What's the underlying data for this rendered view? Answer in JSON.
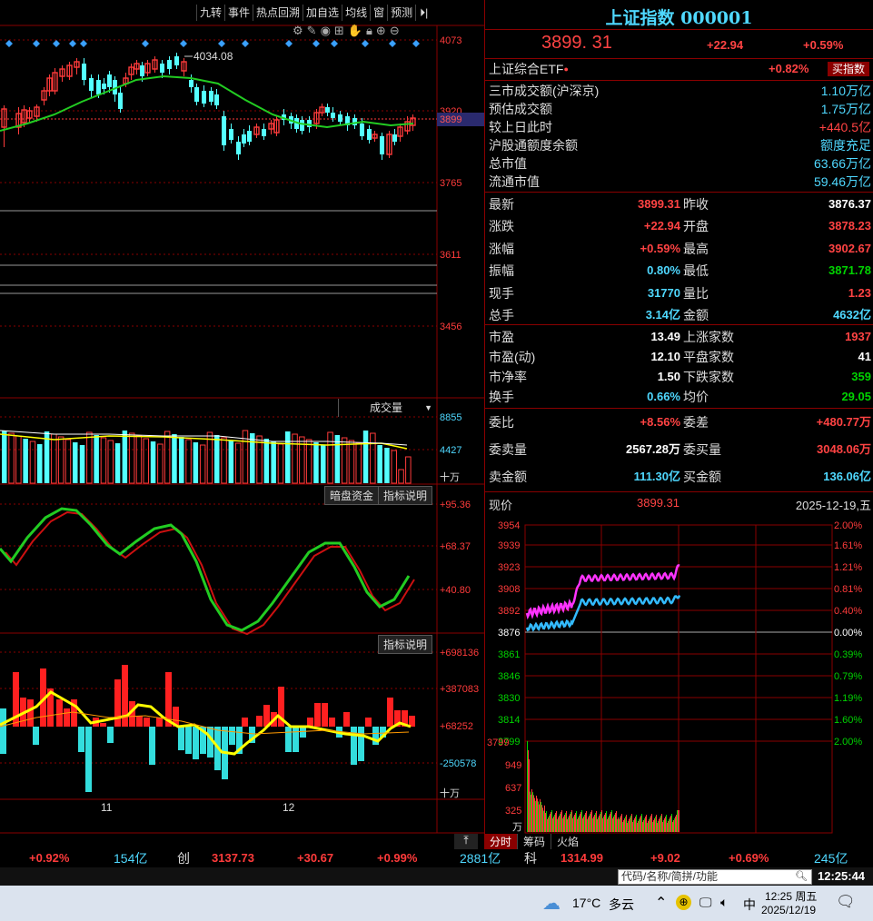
{
  "toolbar": {
    "items": [
      "九转",
      "事件",
      "热点回溯",
      "加自选",
      "均线",
      "窗",
      "预测"
    ]
  },
  "chart_tools": [
    "gear-icon",
    "pen-icon",
    "eye-icon",
    "basket-icon",
    "hand-icon",
    "lock-icon",
    "zoom-in-icon",
    "zoom-out-icon"
  ],
  "main_chart": {
    "price_labels": [
      "4073",
      "3920",
      "3899",
      "3765",
      "3611",
      "3456"
    ],
    "high_label": "4034.08",
    "x_labels": [
      "11",
      "12"
    ],
    "volume_header": "成交量",
    "volume_labels": [
      "8855",
      "4427",
      "十万"
    ],
    "dark_pool_btn": "暗盘资金",
    "indicator_btn": "指标说明",
    "indicator_btn2": "指标说明",
    "osc_labels": [
      "+95.36",
      "+68.37",
      "+40.80"
    ],
    "flow_labels": [
      "+698136",
      "+387083",
      "+68252",
      "-250578",
      "十万"
    ]
  },
  "quote": {
    "title": "上证指数 000001",
    "price": "3899. 31",
    "change": "+22.94",
    "pct": "+0.59%",
    "etf_label": "上证综合ETF",
    "etf_pct": "+0.82%",
    "buy_index_btn": "买指数",
    "info_rows": [
      {
        "label": "三市成交额(沪深京)",
        "value": "1.10万亿"
      },
      {
        "label": "预估成交额",
        "value": "1.75万亿"
      },
      {
        "label": "较上日此时",
        "value": "+440.5亿"
      },
      {
        "label": "沪股通额度余额",
        "value": "额度充足"
      },
      {
        "label": "总市值",
        "value": "63.66万亿"
      },
      {
        "label": "流通市值",
        "value": "59.46万亿"
      }
    ],
    "grid": [
      {
        "l1": "最新",
        "v1": "3899.31",
        "l2": "昨收",
        "v2": "3876.37"
      },
      {
        "l1": "涨跌",
        "v1": "+22.94",
        "l2": "开盘",
        "v2": "3878.23"
      },
      {
        "l1": "涨幅",
        "v1": "+0.59%",
        "l2": "最高",
        "v2": "3902.67"
      },
      {
        "l1": "振幅",
        "v1": "0.80%",
        "l2": "最低",
        "v2": "3871.78"
      },
      {
        "l1": "现手",
        "v1": "31770",
        "l2": "量比",
        "v2": "1.23"
      },
      {
        "l1": "总手",
        "v1": "3.14亿",
        "l2": "金额",
        "v2": "4632亿"
      }
    ],
    "grid2": [
      {
        "l1": "市盈",
        "v1": "13.49",
        "l2": "上涨家数",
        "v2": "1937"
      },
      {
        "l1": "市盈(动)",
        "v1": "12.10",
        "l2": "平盘家数",
        "v2": "41"
      },
      {
        "l1": "市净率",
        "v1": "1.50",
        "l2": "下跌家数",
        "v2": "359"
      },
      {
        "l1": "换手",
        "v1": "0.66%",
        "l2": "均价",
        "v2": "29.05"
      }
    ],
    "grid3": [
      {
        "l1": "委比",
        "v1": "+8.56%",
        "l2": "委差",
        "v2": "+480.77万"
      },
      {
        "l1": "委卖量",
        "v1": "2567.28万",
        "l2": "委买量",
        "v2": "3048.06万"
      },
      {
        "l1": "卖金额",
        "v1": "111.30亿",
        "l2": "买金额",
        "v2": "136.06亿"
      }
    ]
  },
  "intraday": {
    "header_label": "现价",
    "header_price": "3899.31",
    "header_date": "2025-12-19,五",
    "left_labels": [
      "3954",
      "3939",
      "3923",
      "3908",
      "3892",
      "3876",
      "3861",
      "3846",
      "3830",
      "3814",
      "3799"
    ],
    "right_labels": [
      "2.00%",
      "1.61%",
      "1.21%",
      "0.81%",
      "0.40%",
      "0.00%",
      "0.39%",
      "0.79%",
      "1.19%",
      "1.60%",
      "2.00%"
    ],
    "vol_labels": [
      "949",
      "637",
      "325",
      "万"
    ],
    "tabs": [
      "分时",
      "筹码",
      "火焰"
    ]
  },
  "bottom_bar": {
    "items": [
      {
        "text": "+0.92%",
        "color": "red"
      },
      {
        "text": "154亿",
        "color": "cyan"
      },
      {
        "text": "创",
        "color": "white"
      },
      {
        "text": "3137.73",
        "color": "red"
      },
      {
        "text": "+30.67",
        "color": "red"
      },
      {
        "text": "+0.99%",
        "color": "red"
      },
      {
        "text": "2881亿",
        "color": "cyan"
      },
      {
        "text": "科",
        "color": "white"
      },
      {
        "text": "1314.99",
        "color": "red"
      },
      {
        "text": "+9.02",
        "color": "red"
      },
      {
        "text": "+0.69%",
        "color": "red"
      },
      {
        "text": "245亿",
        "color": "cyan"
      }
    ]
  },
  "search": {
    "placeholder": "代码/名称/简拼/功能",
    "time": "12:25:44"
  },
  "taskbar": {
    "temp": "17°C",
    "weather": "多云",
    "ime": "中",
    "clock_time": "12:25 周五",
    "clock_date": "2025/12/19"
  },
  "colors": {
    "up": "#ff3b3b",
    "down": "#54ffff",
    "ma": "#22cc22",
    "frame": "#8a0000"
  }
}
